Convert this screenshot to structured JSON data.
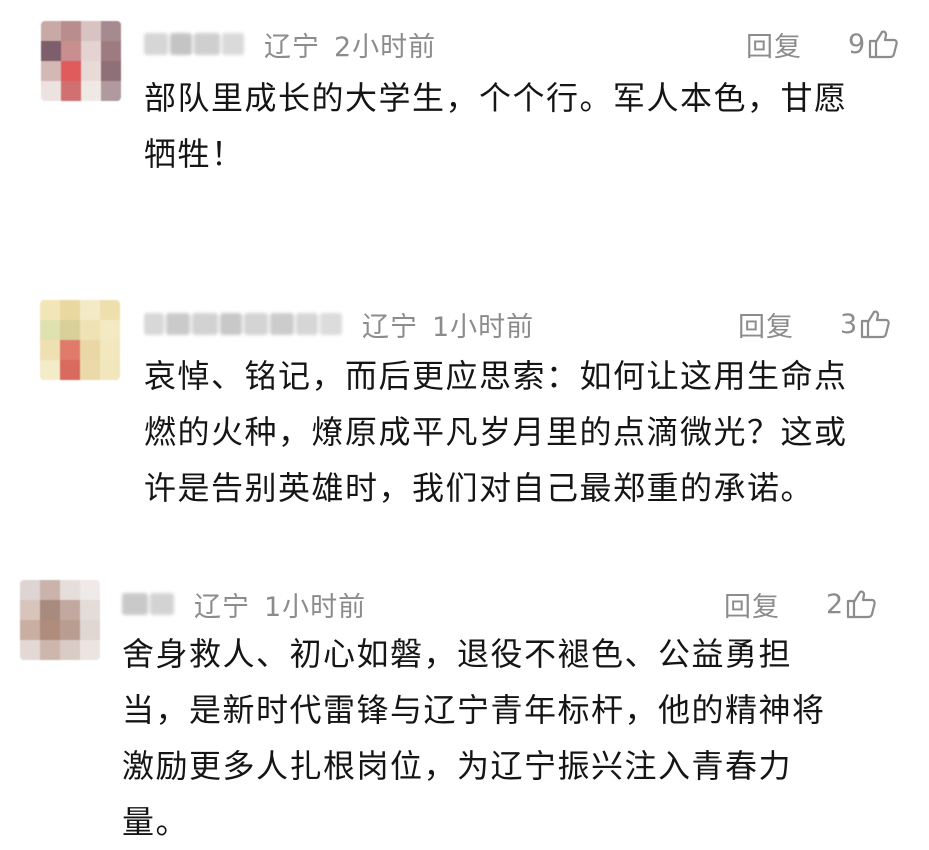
{
  "comments": [
    {
      "region": "辽宁",
      "time": "2小时前",
      "reply_label": "回复",
      "likes": "9",
      "text": "部队里成长的大学生，个个行。军人本色，甘愿\n牺牲！",
      "avatar_palette": [
        "#c9a9a6",
        "#b88d8c",
        "#d8c3c2",
        "#a58b8f",
        "#7d5e6a",
        "#c98e8e",
        "#e4d3d0",
        "#9e7b7f",
        "#d4b8b5",
        "#e05c5c",
        "#e8dad7",
        "#8f6f78",
        "#ece2df",
        "#d07070",
        "#f0e8e5",
        "#b09a9e"
      ]
    },
    {
      "region": "辽宁",
      "time": "1小时前",
      "reply_label": "回复",
      "likes": "3",
      "text": "哀悼、铭记，而后更应思索：如何让这用生命点\n燃的火种，燎原成平凡岁月里的点滴微光？这或\n许是告别英雄时，我们对自己最郑重的承诺。",
      "avatar_palette": [
        "#f2e6b8",
        "#e9d9a0",
        "#f4eac6",
        "#eee0ad",
        "#dfe2b0",
        "#d9cf98",
        "#efe3b4",
        "#f3e9c2",
        "#efe0b2",
        "#e07a6a",
        "#e9d7a6",
        "#f2e7bd",
        "#f4ebc8",
        "#d96a5e",
        "#eadaa9",
        "#f1e6bc"
      ]
    },
    {
      "region": "辽宁",
      "time": "1小时前",
      "reply_label": "回复",
      "likes": "2",
      "text": "舍身救人、初心如磐，退役不褪色、公益勇担\n当，是新时代雷锋与辽宁青年标杆，他的精神将\n激励更多人扎根岗位，为辽宁振兴注入青春力\n量。",
      "avatar_palette": [
        "#ded5d2",
        "#c9b3ab",
        "#e6dedb",
        "#efe9e7",
        "#d8c4bb",
        "#a88a7e",
        "#c2a89e",
        "#e4dcd9",
        "#c9aea2",
        "#b08c7d",
        "#b99d90",
        "#e0d6d2",
        "#e3d8d4",
        "#cdb7ad",
        "#d9cbc5",
        "#ebe5e2"
      ]
    }
  ]
}
